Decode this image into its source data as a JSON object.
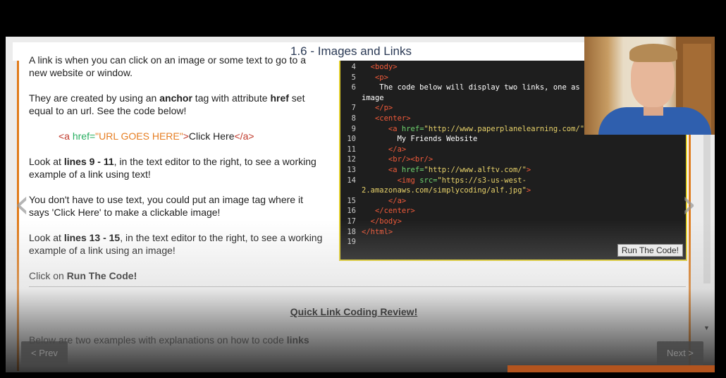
{
  "lesson": {
    "title": "1.6 - Images and Links",
    "intro_line1": "A link is when you can click on an image or some text to go to a",
    "intro_line2": "new website or window.",
    "created_a": "They are created by using an ",
    "created_b": "anchor",
    "created_c": " tag with attribute ",
    "created_d": "href",
    "created_e": " set",
    "created_line2": "equal to an url. See the code below!",
    "example": {
      "open_lt": "<a ",
      "attr": "href=",
      "value": "\"URL GOES HERE\"",
      "close_gt": ">",
      "text": "Click Here",
      "end_tag": "</a>"
    },
    "look1_a": "Look at ",
    "look1_b": "lines 9 - 11",
    "look1_c": ", in the text editor to the right, to see a working",
    "look1_line2": "example of a link using text!",
    "image_line1": "You don't have to use text, you could put an image tag where it",
    "image_line2": "says 'Click Here' to make a clickable image!",
    "look2_a": "Look at ",
    "look2_b": "lines 13 - 15",
    "look2_c": ", in the text editor to the right, to see a working",
    "look2_line2": "example of a link using an image!",
    "click_a": "Click on ",
    "click_b": "Run The Code!",
    "review_title": "Quick Link Coding Review!",
    "cutoff_a": "Below are two examples with explanations on how to code ",
    "cutoff_b": "links"
  },
  "editor": {
    "lines": [
      {
        "n": "4",
        "parts": [
          {
            "c": "k",
            "v": "  <body>"
          }
        ]
      },
      {
        "n": "5",
        "parts": [
          {
            "c": "k",
            "v": "   <p>"
          }
        ]
      },
      {
        "n": "6",
        "parts": [
          {
            "c": "t",
            "v": "    The code below will display two links, one as te"
          }
        ]
      },
      {
        "n": "",
        "parts": [
          {
            "c": "t",
            "v": "image"
          }
        ]
      },
      {
        "n": "7",
        "parts": [
          {
            "c": "k",
            "v": "   </p>"
          }
        ]
      },
      {
        "n": "8",
        "parts": [
          {
            "c": "k",
            "v": "   <center>"
          }
        ]
      },
      {
        "n": "9",
        "parts": [
          {
            "c": "k",
            "v": "      <a "
          },
          {
            "c": "a",
            "v": "href="
          },
          {
            "c": "s",
            "v": "\"http://www.paperplanelearning.com/\""
          },
          {
            "c": "k",
            "v": ">"
          }
        ]
      },
      {
        "n": "10",
        "parts": [
          {
            "c": "t",
            "v": "        My Friends Website"
          }
        ]
      },
      {
        "n": "11",
        "parts": [
          {
            "c": "k",
            "v": "      </a>"
          }
        ]
      },
      {
        "n": "12",
        "parts": [
          {
            "c": "k",
            "v": "      <br/><br/>"
          }
        ]
      },
      {
        "n": "13",
        "parts": [
          {
            "c": "k",
            "v": "      <a "
          },
          {
            "c": "a",
            "v": "href="
          },
          {
            "c": "s",
            "v": "\"http://www.alftv.com/\""
          },
          {
            "c": "k",
            "v": ">"
          }
        ]
      },
      {
        "n": "14",
        "parts": [
          {
            "c": "k",
            "v": "        <img "
          },
          {
            "c": "a",
            "v": "src="
          },
          {
            "c": "s",
            "v": "\"https://s3-us-west-"
          }
        ]
      },
      {
        "n": "",
        "parts": [
          {
            "c": "s",
            "v": "2.amazonaws.com/simplycoding/alf.jpg\""
          },
          {
            "c": "k",
            "v": ">"
          }
        ]
      },
      {
        "n": "15",
        "parts": [
          {
            "c": "k",
            "v": "      </a>"
          }
        ]
      },
      {
        "n": "16",
        "parts": [
          {
            "c": "k",
            "v": "   </center>"
          }
        ]
      },
      {
        "n": "17",
        "parts": [
          {
            "c": "k",
            "v": "  </body>"
          }
        ]
      },
      {
        "n": "18",
        "parts": [
          {
            "c": "k",
            "v": "</html>"
          }
        ]
      },
      {
        "n": "19",
        "parts": []
      }
    ],
    "run_label": "Run The Code!"
  },
  "nav": {
    "prev_label": "< Prev",
    "next_label": "Next >",
    "left_arrow": "‹",
    "right_arrow": "›"
  },
  "scroll": {
    "down_arrow": "▼"
  }
}
